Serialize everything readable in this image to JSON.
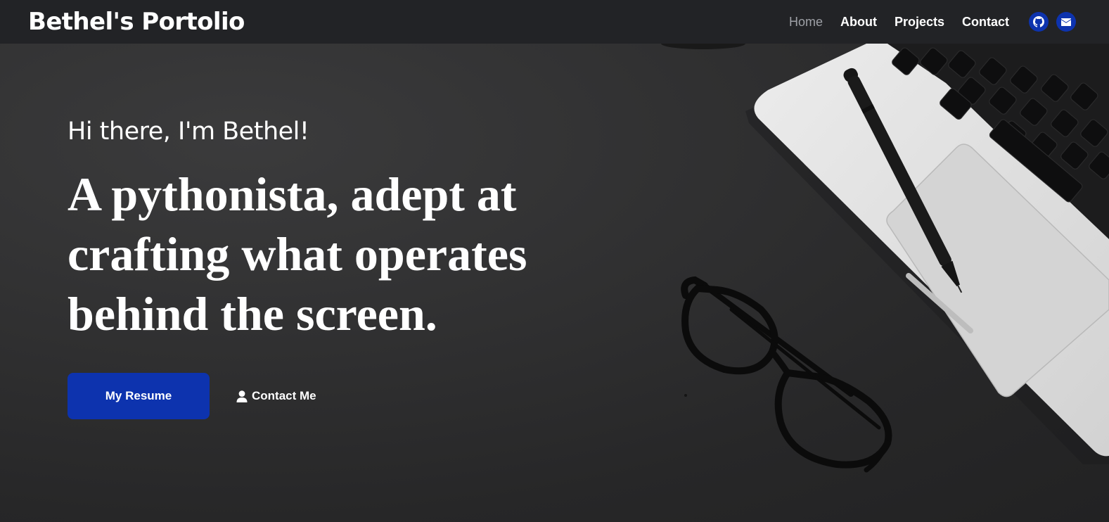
{
  "navbar": {
    "brand": "Bethel's Portolio",
    "links": [
      {
        "label": "Home",
        "active": true
      },
      {
        "label": "About",
        "active": false
      },
      {
        "label": "Projects",
        "active": false
      },
      {
        "label": "Contact",
        "active": false
      }
    ],
    "social_icons": [
      "github-icon",
      "envelope-icon"
    ]
  },
  "hero": {
    "greeting": "Hi there, I'm Bethel!",
    "headline": "A pythonista, adept at crafting what operates behind the screen.",
    "primary_button": "My Resume",
    "secondary_button": "Contact Me",
    "secondary_button_icon": "user-icon"
  },
  "colors": {
    "navbar_bg": "#222326",
    "accent": "#0d33ae",
    "active_link": "#9ea0a6",
    "text": "#ffffff"
  }
}
